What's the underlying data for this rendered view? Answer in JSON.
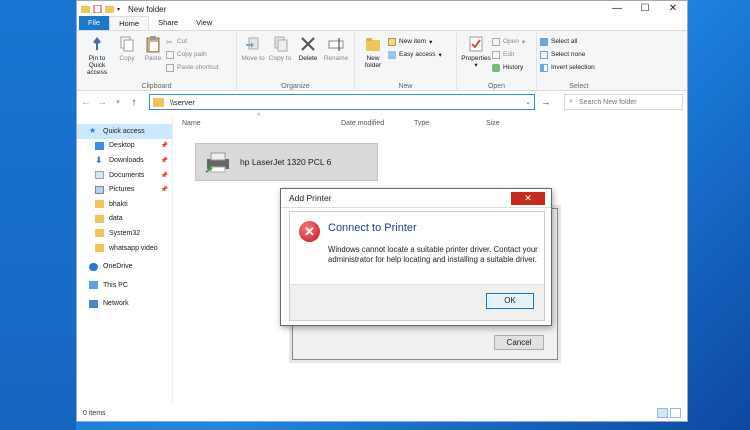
{
  "window": {
    "title": "New folder",
    "controls": [
      "—",
      "☐",
      "✕"
    ]
  },
  "tabs": [
    "File",
    "Home",
    "Share",
    "View"
  ],
  "ribbon": {
    "clipboard": {
      "pin_label": "Pin to Quick access",
      "copy_label": "Copy",
      "paste_label": "Paste",
      "cut_label": "Cut",
      "copy_path_label": "Copy path",
      "paste_shortcut_label": "Paste shortcut",
      "group_label": "Clipboard"
    },
    "organize": {
      "move_to_label": "Move to",
      "copy_to_label": "Copy to",
      "delete_label": "Delete",
      "rename_label": "Rename",
      "group_label": "Organize"
    },
    "new": {
      "new_folder_label": "New folder",
      "new_item_label": "New item",
      "easy_access_label": "Easy access",
      "group_label": "New"
    },
    "open": {
      "properties_label": "Properties",
      "open_label": "Open",
      "edit_label": "Edit",
      "history_label": "History",
      "group_label": "Open"
    },
    "select": {
      "select_all_label": "Select all",
      "select_none_label": "Select none",
      "invert_label": "Invert selection",
      "group_label": "Select"
    }
  },
  "address": {
    "path": "\\\\server",
    "search_placeholder": "Search New folder"
  },
  "sidebar": {
    "items": [
      {
        "label": "Quick access",
        "pinned": false
      },
      {
        "label": "Desktop",
        "pinned": true
      },
      {
        "label": "Downloads",
        "pinned": true
      },
      {
        "label": "Documents",
        "pinned": true
      },
      {
        "label": "Pictures",
        "pinned": true
      },
      {
        "label": "bhakti",
        "pinned": false
      },
      {
        "label": "data",
        "pinned": false
      },
      {
        "label": "System32",
        "pinned": false
      },
      {
        "label": "whatsapp video",
        "pinned": false
      },
      {
        "label": "OneDrive",
        "pinned": false
      },
      {
        "label": "This PC",
        "pinned": false
      },
      {
        "label": "Network",
        "pinned": false
      }
    ]
  },
  "columns": {
    "name": "Name",
    "date": "Date modified",
    "type": "Type",
    "size": "Size"
  },
  "printer": {
    "name": "hp LaserJet 1320 PCL 6"
  },
  "status": {
    "items": "0 items"
  },
  "dialog": {
    "title": "Add Printer",
    "close": "✕",
    "heading": "Connect to Printer",
    "message": "Windows cannot locate a suitable printer driver. Contact your administrator for help locating and installing a suitable driver.",
    "ok_label": "OK",
    "cancel_label": "Cancel"
  },
  "colors": {
    "accent": "#1979ca",
    "error": "#c50f1f",
    "heading": "#1c3f94"
  }
}
